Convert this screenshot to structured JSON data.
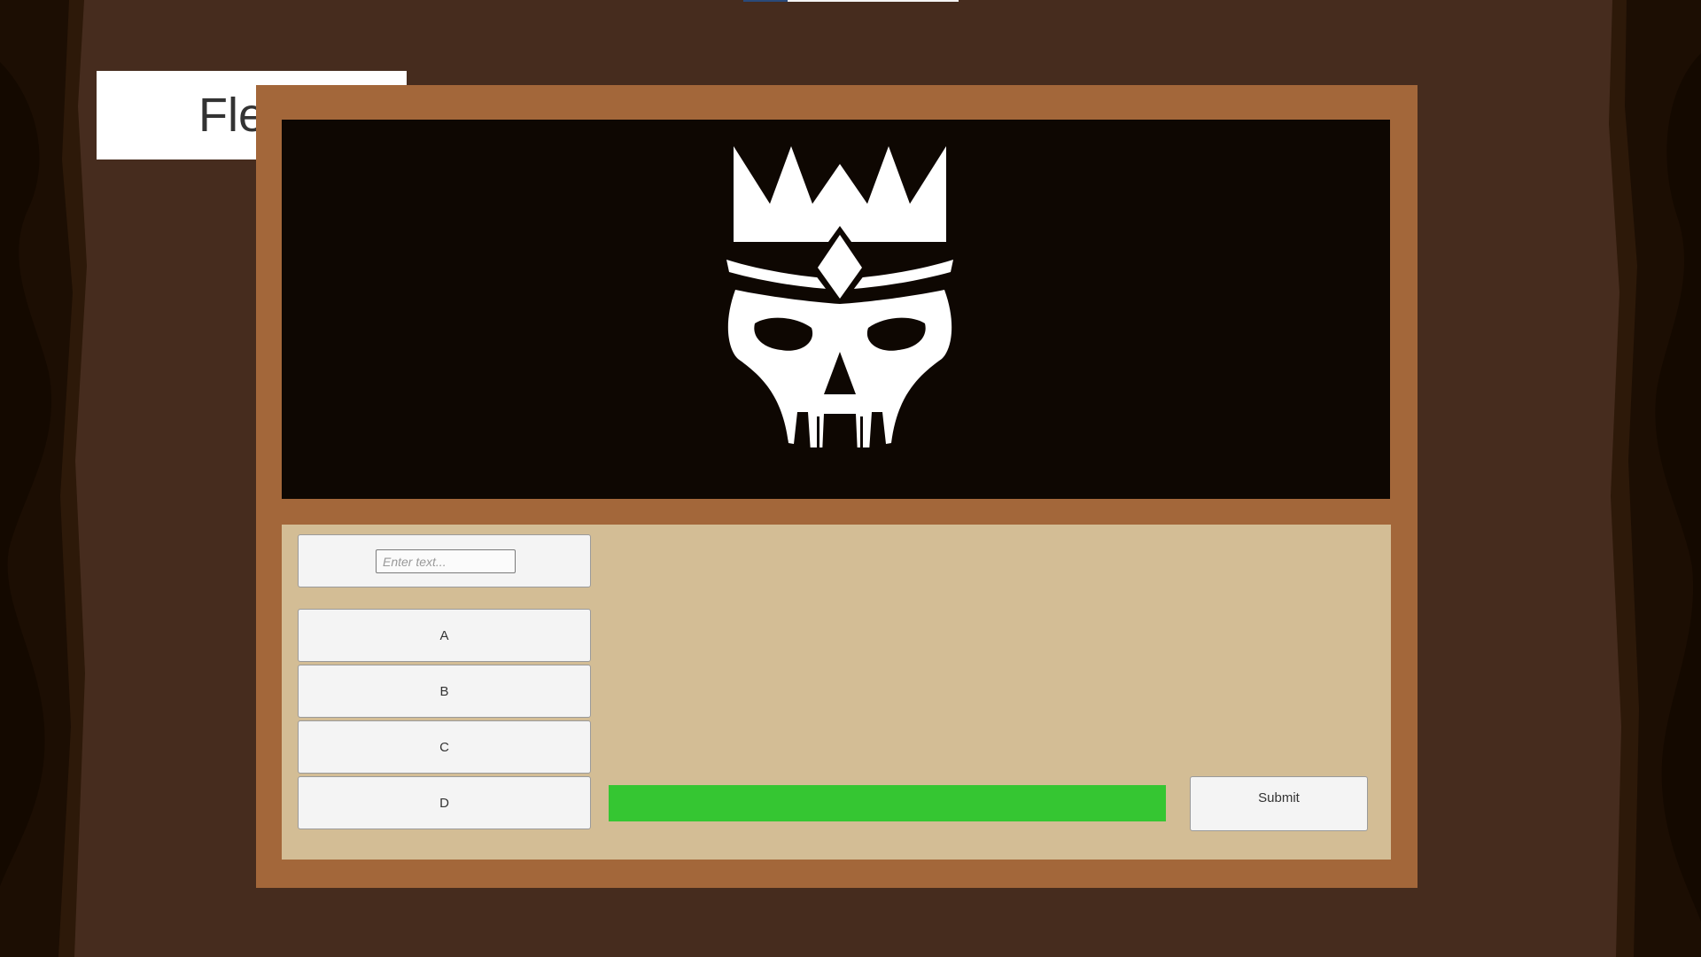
{
  "colors": {
    "background": "#462c1e",
    "board_frame": "#a3673a",
    "viewport": "#0e0702",
    "panel": "#d3bd95",
    "timer_fill": "#35c632",
    "button_face": "#f4f4f4"
  },
  "header": {
    "flee_label": "Flee!"
  },
  "enemy": {
    "icon": "crowned-skull-icon"
  },
  "answer": {
    "placeholder": "Enter text...",
    "value": ""
  },
  "options": [
    {
      "label": "A"
    },
    {
      "label": "B"
    },
    {
      "label": "C"
    },
    {
      "label": "D"
    }
  ],
  "timer": {
    "remaining_fraction": 1.0
  },
  "submit": {
    "label": "Submit"
  }
}
